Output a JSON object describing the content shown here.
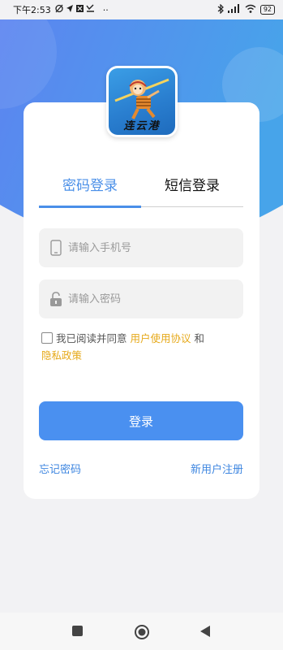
{
  "status_bar": {
    "time": "下午2:53",
    "battery": "92",
    "dots": "··"
  },
  "app_logo": {
    "text": "连云港"
  },
  "tabs": [
    {
      "label": "密码登录",
      "active": true
    },
    {
      "label": "短信登录",
      "active": false
    }
  ],
  "form": {
    "phone_placeholder": "请输入手机号",
    "password_placeholder": "请输入密码"
  },
  "agreement": {
    "prefix": "我已阅读并同意",
    "user_agreement": "用户使用协议",
    "and": "和",
    "privacy_policy": "隐私政策",
    "checked": false
  },
  "login_button": "登录",
  "links": {
    "forgot_password": "忘记密码",
    "register": "新用户注册"
  },
  "colors": {
    "accent": "#4a8fe8",
    "button": "#4a90f0",
    "link_highlight": "#e6a91a",
    "header_gradient_start": "#5b86f0",
    "header_gradient_end": "#4aa3ea"
  }
}
